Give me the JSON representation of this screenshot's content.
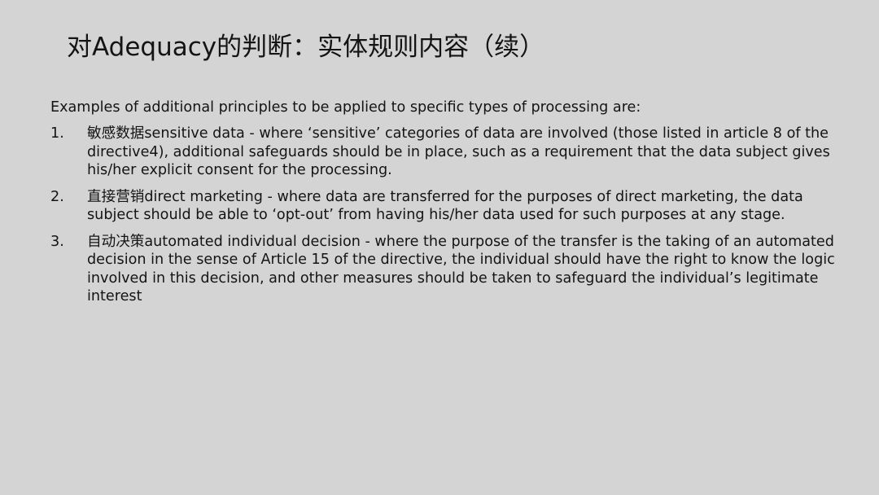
{
  "slide": {
    "title": "对Adequacy的判断：实体规则内容（续）",
    "intro": "Examples of additional principles to be applied to specific types of processing are:",
    "items": [
      {
        "number": "1.",
        "text": "敏感数据sensitive data - where ‘sensitive’ categories of data are involved (those listed in article 8 of the directive4), additional safeguards should be in place, such as a requirement that the data subject gives his/her explicit consent for the processing."
      },
      {
        "number": "2.",
        "text": "直接营销direct marketing - where data are transferred for the purposes of direct marketing, the data subject should be able to ‘opt-out’ from having his/her data used for such purposes at any stage."
      },
      {
        "number": "3.",
        "text": "自动决策automated individual decision - where the purpose of the transfer is the taking of an automated decision in the sense of Article 15 of the directive, the individual should have the right to know the logic involved in this decision, and other measures should be taken to safeguard the individual’s legitimate interest"
      }
    ]
  }
}
